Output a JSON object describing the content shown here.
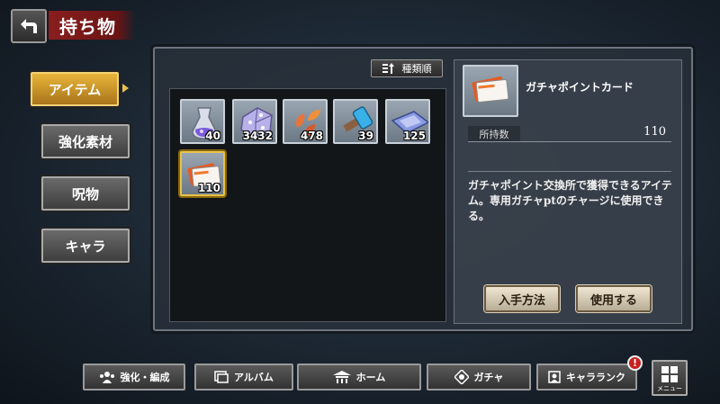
{
  "header": {
    "title": "持ち物"
  },
  "sidebar": {
    "tabs": [
      {
        "label": "アイテム",
        "active": true
      },
      {
        "label": "強化素材",
        "active": false
      },
      {
        "label": "呪物",
        "active": false
      },
      {
        "label": "キャラ",
        "active": false
      }
    ]
  },
  "sort": {
    "label": "種類順",
    "icon": "sort-icon"
  },
  "inventory": {
    "items": [
      {
        "icon": "potion-icon",
        "count": "40"
      },
      {
        "icon": "crystal-dice-icon",
        "count": "3432"
      },
      {
        "icon": "leaf-icon",
        "count": "478"
      },
      {
        "icon": "hammer-icon",
        "count": "39"
      },
      {
        "icon": "cloth-icon",
        "count": "125"
      },
      {
        "icon": "gacha-card-icon",
        "count": "110",
        "selected": true
      }
    ]
  },
  "detail": {
    "name": "ガチャポイントカード",
    "owned_label": "所持数",
    "owned_value": "110",
    "description": "ガチャポイント交換所で獲得できるアイテム。専用ガチャptのチャージに使用できる。",
    "buttons": {
      "obtain": "入手方法",
      "use": "使用する"
    }
  },
  "bottom_nav": {
    "items": [
      {
        "label": "強化・編成",
        "icon": "team-icon"
      },
      {
        "label": "アルバム",
        "icon": "album-icon"
      },
      {
        "label": "ホーム",
        "icon": "home-icon"
      },
      {
        "label": "ガチャ",
        "icon": "gacha-icon"
      },
      {
        "label": "キャラランク",
        "icon": "rank-icon"
      }
    ],
    "menu_label": "メニュー",
    "alert": "!"
  },
  "colors": {
    "accent_gold": "#e8b53a",
    "banner_red": "#8a1e1e",
    "alert_red": "#c82020"
  }
}
